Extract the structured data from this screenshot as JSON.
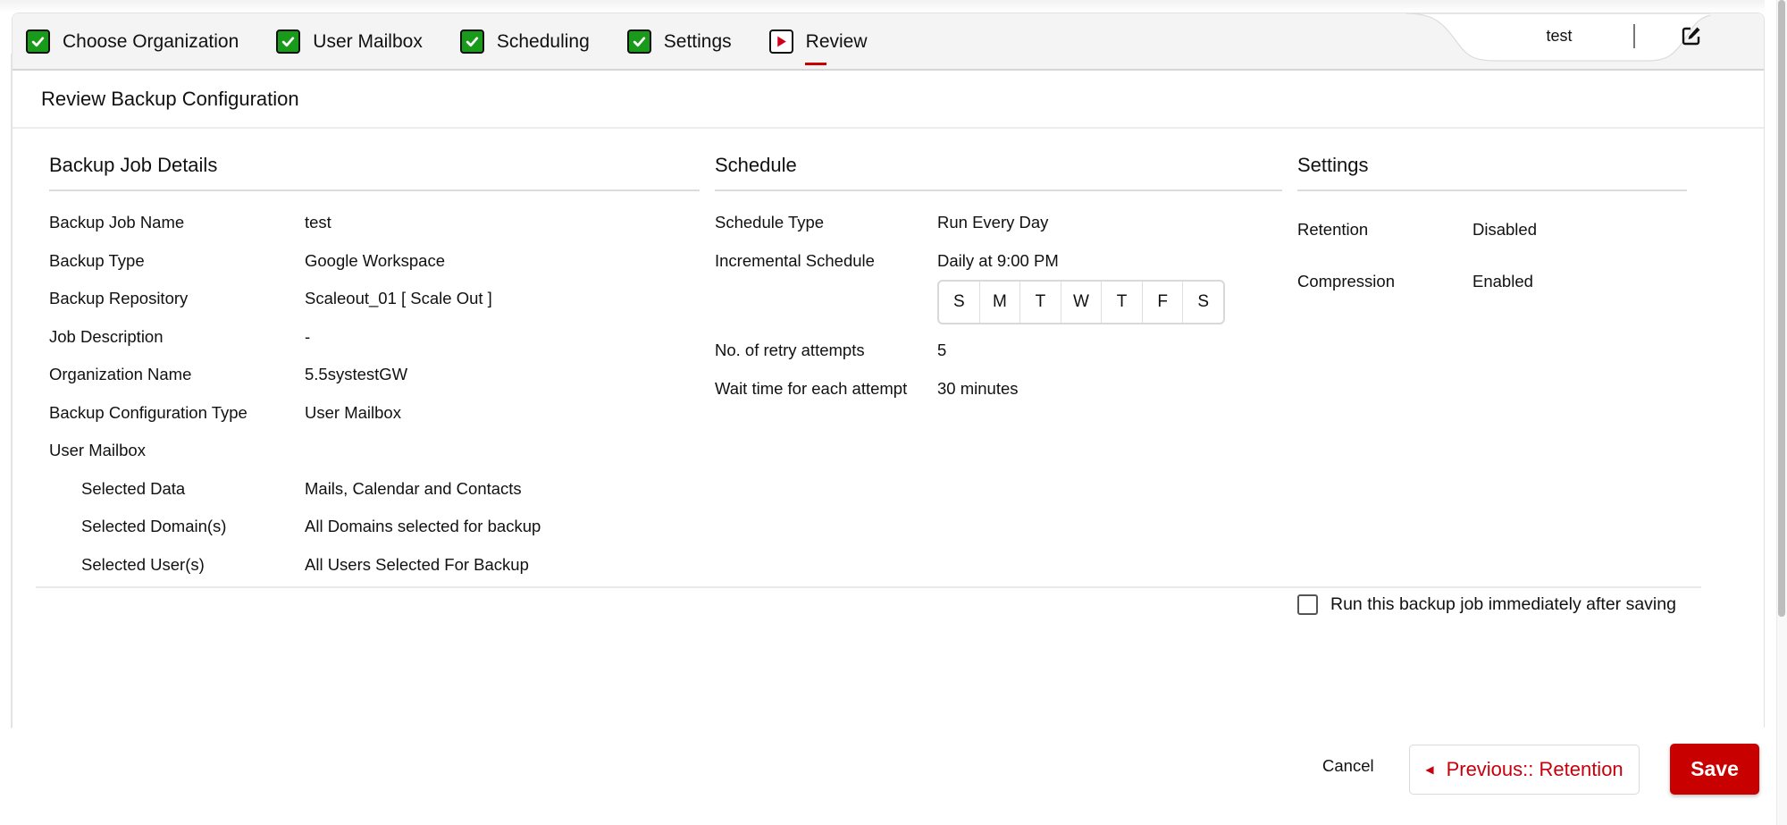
{
  "wizard": {
    "steps": [
      {
        "label": "Choose Organization",
        "status": "completed",
        "icon": "checkbox-checked-icon"
      },
      {
        "label": "User Mailbox",
        "status": "completed",
        "icon": "checkbox-checked-icon"
      },
      {
        "label": "Scheduling",
        "status": "completed",
        "icon": "checkbox-checked-icon"
      },
      {
        "label": "Settings",
        "status": "completed",
        "icon": "checkbox-checked-icon"
      },
      {
        "label": "Review",
        "status": "current",
        "icon": "play-icon"
      }
    ],
    "job_name_tab": "test",
    "edit_icon": "edit-icon"
  },
  "page": {
    "title": "Review Backup Configuration"
  },
  "backup_job_details": {
    "title": "Backup Job Details",
    "rows": [
      {
        "label": "Backup Job Name",
        "value": "test"
      },
      {
        "label": "Backup Type",
        "value": "Google Workspace"
      },
      {
        "label": "Backup Repository",
        "value": "Scaleout_01 [ Scale Out ]"
      },
      {
        "label": "Job Description",
        "value": "-"
      },
      {
        "label": "Organization Name",
        "value": "5.5systestGW"
      },
      {
        "label": "Backup Configuration Type",
        "value": "User Mailbox"
      }
    ],
    "user_mailbox": {
      "label": "User Mailbox",
      "rows": [
        {
          "label": "Selected Data",
          "value": "Mails, Calendar and Contacts"
        },
        {
          "label": "Selected Domain(s)",
          "value": "All Domains selected for backup"
        },
        {
          "label": "Selected User(s)",
          "value": "All Users Selected For Backup"
        }
      ]
    }
  },
  "schedule": {
    "title": "Schedule",
    "schedule_type": {
      "label": "Schedule Type",
      "value": "Run Every Day"
    },
    "incremental": {
      "label": "Incremental Schedule",
      "value": "Daily at 9:00 PM"
    },
    "days": [
      "S",
      "M",
      "T",
      "W",
      "T",
      "F",
      "S"
    ],
    "retry": {
      "label": "No. of retry attempts",
      "value": "5"
    },
    "wait": {
      "label": "Wait time for each attempt",
      "value": "30 minutes"
    }
  },
  "settings": {
    "title": "Settings",
    "rows": [
      {
        "label": "Retention",
        "value": "Disabled"
      },
      {
        "label": "Compression",
        "value": "Enabled"
      }
    ]
  },
  "run_now": {
    "label": "Run this backup job immediately after saving",
    "checked": false
  },
  "footer": {
    "cancel": "Cancel",
    "previous": "Previous:: Retention",
    "save": "Save"
  },
  "colors": {
    "accent": "#c80000",
    "completed_step": "#1a9a1a"
  }
}
